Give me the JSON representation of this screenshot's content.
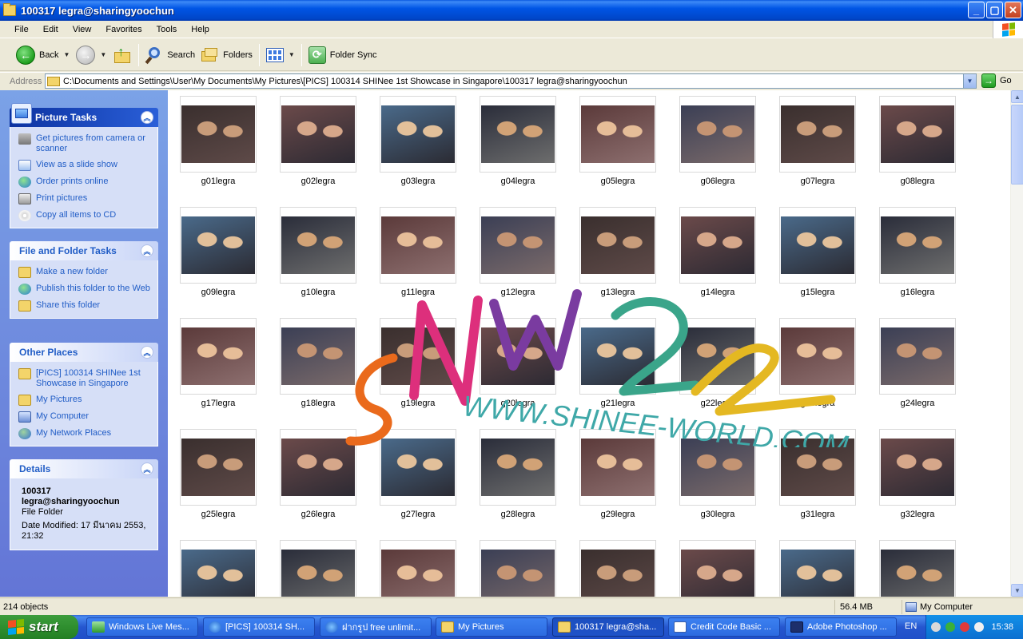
{
  "window": {
    "title": "100317 legra@sharingyoochun",
    "minimize_label": "_",
    "maximize_label": "▢",
    "close_label": "✕"
  },
  "menu": [
    "File",
    "Edit",
    "View",
    "Favorites",
    "Tools",
    "Help"
  ],
  "toolbar": {
    "back_label": "Back",
    "search_label": "Search",
    "folders_label": "Folders",
    "sync_label": "Folder Sync"
  },
  "address": {
    "label": "Address",
    "value": "C:\\Documents and Settings\\User\\My Documents\\My Pictures\\[PICS] 100314 SHINee 1st Showcase in Singapore\\100317 legra@sharingyoochun",
    "go_label": "Go"
  },
  "sidebar": {
    "picture_tasks": {
      "title": "Picture Tasks",
      "items": [
        {
          "label": "Get pictures from camera or scanner",
          "icon": "camera-icon"
        },
        {
          "label": "View as a slide show",
          "icon": "slideshow-icon"
        },
        {
          "label": "Order prints online",
          "icon": "globe-icon"
        },
        {
          "label": "Print pictures",
          "icon": "printer-icon"
        },
        {
          "label": "Copy all items to CD",
          "icon": "cd-icon"
        }
      ]
    },
    "file_folder_tasks": {
      "title": "File and Folder Tasks",
      "items": [
        {
          "label": "Make a new folder",
          "icon": "new-folder-icon"
        },
        {
          "label": "Publish this folder to the Web",
          "icon": "globe-icon"
        },
        {
          "label": "Share this folder",
          "icon": "share-folder-icon"
        }
      ]
    },
    "other_places": {
      "title": "Other Places",
      "items": [
        {
          "label": "[PICS] 100314 SHINee 1st Showcase in Singapore",
          "icon": "folder-icon"
        },
        {
          "label": "My Pictures",
          "icon": "my-pictures-icon"
        },
        {
          "label": "My Computer",
          "icon": "my-computer-icon"
        },
        {
          "label": "My Network Places",
          "icon": "network-places-icon"
        }
      ]
    },
    "details": {
      "title": "Details",
      "name": "100317 legra@sharingyoochun",
      "type": "File Folder",
      "modified": "Date Modified: 17 มีนาคม 2553, 21:32"
    }
  },
  "files": [
    "g01legra",
    "g02legra",
    "g03legra",
    "g04legra",
    "g05legra",
    "g06legra",
    "g07legra",
    "g08legra",
    "g09legra",
    "g10legra",
    "g11legra",
    "g12legra",
    "g13legra",
    "g14legra",
    "g15legra",
    "g16legra",
    "g17legra",
    "g18legra",
    "g19legra",
    "g20legra",
    "g21legra",
    "g22legra",
    "g23legra",
    "g24legra",
    "g25legra",
    "g26legra",
    "g27legra",
    "g28legra",
    "g29legra",
    "g30legra",
    "g31legra",
    "g32legra",
    "",
    "",
    "",
    "",
    "",
    "",
    "",
    ""
  ],
  "watermark": {
    "letters": "SNW2",
    "url": "WWW.SHINEE-WORLD.COM"
  },
  "status": {
    "count": "214 objects",
    "size": "56.4 MB",
    "location": "My Computer"
  },
  "taskbar": {
    "start_label": "start",
    "tasks": [
      {
        "label": "Windows Live Mes...",
        "icon": "messenger-icon"
      },
      {
        "label": "[PICS] 100314 SH...",
        "icon": "ie-icon"
      },
      {
        "label": "ฝากรูป free unlimit...",
        "icon": "ie-icon"
      },
      {
        "label": "My Pictures",
        "icon": "folder-icon"
      },
      {
        "label": "100317 legra@sha...",
        "icon": "folder-icon"
      },
      {
        "label": "Credit Code Basic ...",
        "icon": "document-icon"
      },
      {
        "label": "Adobe Photoshop ...",
        "icon": "photoshop-icon"
      }
    ],
    "language": "EN",
    "clock": "15:38"
  }
}
